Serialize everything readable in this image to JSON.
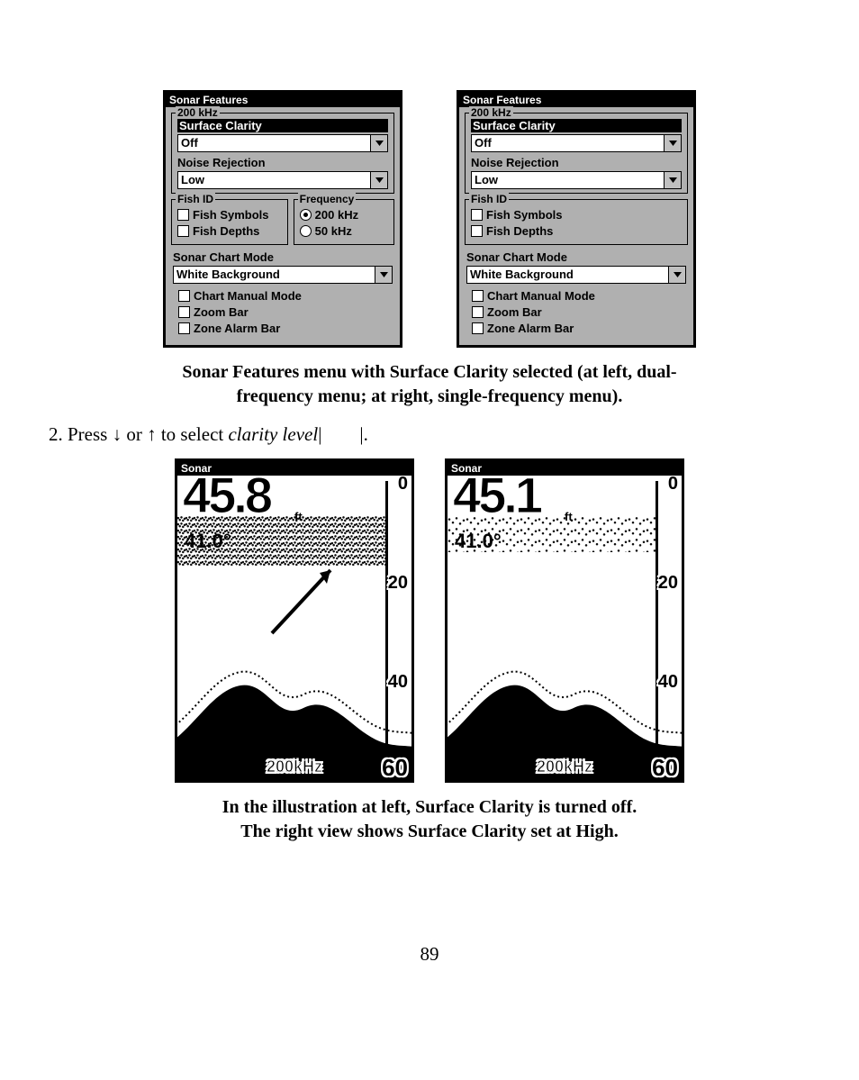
{
  "menus": {
    "title": "Sonar Features",
    "group200": "200 kHz",
    "surfaceClarity": {
      "label": "Surface Clarity",
      "value": "Off"
    },
    "noiseRejection": {
      "label": "Noise Rejection",
      "value": "Low"
    },
    "fishId": {
      "legend": "Fish ID",
      "symbols": "Fish Symbols",
      "depths": "Fish Depths"
    },
    "frequency": {
      "legend": "Frequency",
      "opt200": "200 kHz",
      "opt50": "50 kHz"
    },
    "chartMode": {
      "label": "Sonar Chart Mode",
      "value": "White Background"
    },
    "manual": "Chart Manual Mode",
    "zoom": "Zoom Bar",
    "zoneAlarm": "Zone Alarm Bar"
  },
  "caption1a": "Sonar Features menu with Surface Clarity selected (at left, dual-",
  "caption1b": "frequency menu; at right, single-frequency menu).",
  "step": {
    "num": "2.",
    "textA": "Press ",
    "down": "↓",
    "or": " or ",
    "up": "↑",
    "textB": " to select ",
    "ital": "clarity level",
    "bars": "|        |",
    "dot": "."
  },
  "sonar": {
    "title": "Sonar",
    "left": {
      "depth": "45.8",
      "unit": "ft",
      "temp": "41.0°",
      "s0": "0",
      "s20": "20",
      "s40": "40",
      "s60": "60",
      "freq": "200kHz"
    },
    "right": {
      "depth": "45.1",
      "unit": "ft",
      "temp": "41.0°",
      "s0": "0",
      "s20": "20",
      "s40": "40",
      "s60": "60",
      "freq": "200kHz"
    }
  },
  "caption2a": "In the illustration at left, Surface Clarity is turned off.",
  "caption2b": "The right view shows Surface Clarity set at High.",
  "pageNumber": "89"
}
